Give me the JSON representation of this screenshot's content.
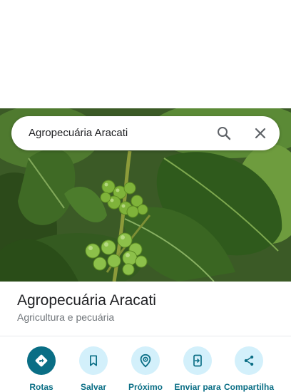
{
  "search": {
    "query": "Agropecuária Aracati"
  },
  "place": {
    "name": "Agropecuária Aracati",
    "category": "Agricultura e pecuária"
  },
  "actions": [
    {
      "label": "Rotas",
      "icon": "directions-icon"
    },
    {
      "label": "Salvar",
      "icon": "bookmark-icon"
    },
    {
      "label": "Próximo",
      "icon": "nearby-icon"
    },
    {
      "label": "Enviar para",
      "icon": "send-to-phone-icon"
    },
    {
      "label": "Compartilha",
      "icon": "share-icon"
    }
  ],
  "colors": {
    "accent": "#0a6e85",
    "accent_light": "#d3f0fb",
    "text": "#202124",
    "subtext": "#70757a"
  }
}
